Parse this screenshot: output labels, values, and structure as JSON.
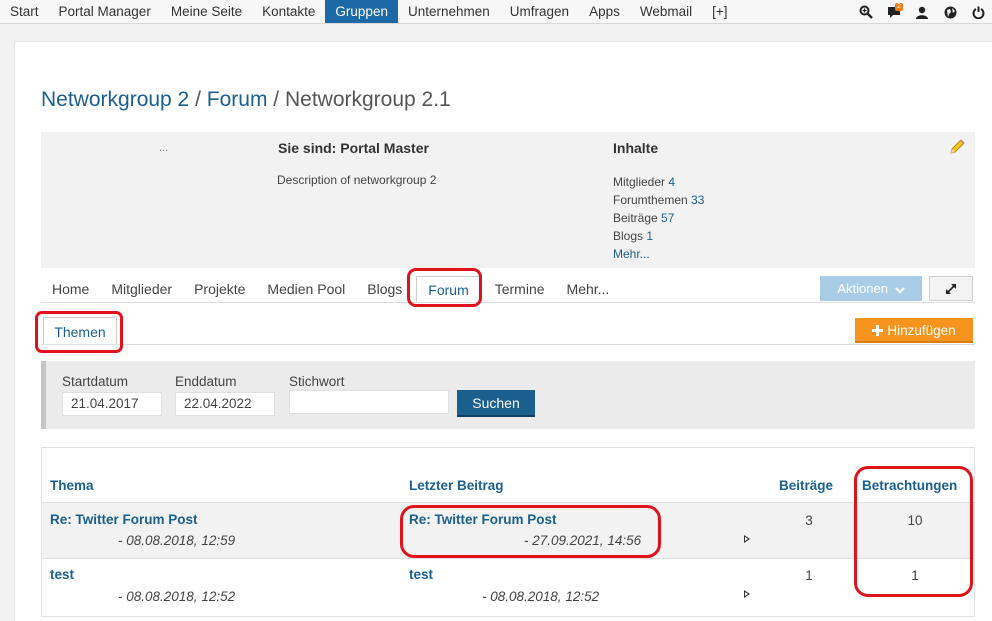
{
  "topnav": {
    "items": [
      "Start",
      "Portal Manager",
      "Meine Seite",
      "Kontakte",
      "Gruppen",
      "Unternehmen",
      "Umfragen",
      "Apps",
      "Webmail",
      "[+]"
    ],
    "active_index": 4,
    "notification_count": "2"
  },
  "breadcrumb": {
    "part1": "Networkgroup 2",
    "sep1": " / ",
    "part2": "Forum",
    "sep2": " / ",
    "current": "Networkgroup 2.1"
  },
  "info": {
    "dots": "...",
    "role": "Sie sind: Portal Master",
    "description": "Description of networkgroup 2",
    "contents_title": "Inhalte",
    "stats": [
      {
        "label": "Mitglieder",
        "value": "4"
      },
      {
        "label": "Forumthemen",
        "value": "33"
      },
      {
        "label": "Beiträge",
        "value": "57"
      },
      {
        "label": "Blogs",
        "value": "1"
      }
    ],
    "more": "Mehr..."
  },
  "tabs": [
    "Home",
    "Mitglieder",
    "Projekte",
    "Medien Pool",
    "Blogs",
    "Forum",
    "Termine",
    "Mehr..."
  ],
  "active_tab": "Forum",
  "aktionen_label": "Aktionen",
  "subtab_label": "Themen",
  "add_label": "Hinzufügen",
  "filter": {
    "start_label": "Startdatum",
    "start_value": "21.04.2017",
    "end_label": "Enddatum",
    "end_value": "22.04.2022",
    "keyword_label": "Stichwort",
    "keyword_value": "",
    "search_label": "Suchen"
  },
  "table": {
    "headers": {
      "thema": "Thema",
      "letzter": "Letzter Beitrag",
      "beitraege": "Beiträge",
      "betrachtungen": "Betrachtungen"
    },
    "rows": [
      {
        "thema": "Re: Twitter Forum Post",
        "thema_date": "- 08.08.2018, 12:59",
        "last": "Re: Twitter Forum Post",
        "last_date": "- 27.09.2021, 14:56",
        "beitraege": "3",
        "betrachtungen": "10"
      },
      {
        "thema": "test",
        "thema_date": "- 08.08.2018, 12:52",
        "last": "test",
        "last_date": "- 08.08.2018, 12:52",
        "beitraege": "1",
        "betrachtungen": "1"
      }
    ]
  },
  "colors": {
    "brand": "#1b6aa5",
    "link": "#1b5f8f",
    "add": "#f7941d",
    "annotation": "#e0121b"
  }
}
